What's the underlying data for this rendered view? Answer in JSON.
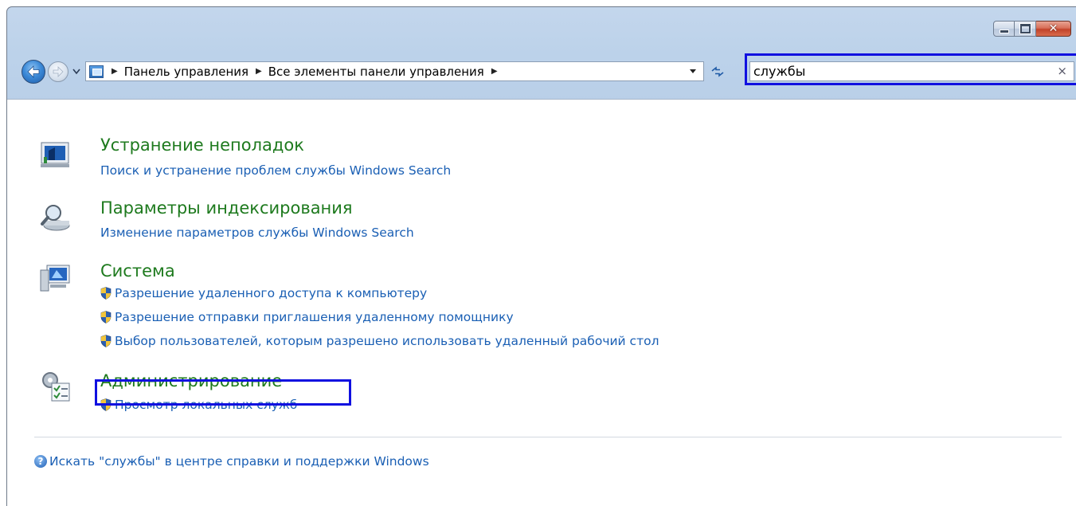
{
  "window": {
    "caption_buttons": {
      "minimize_icon": "minimize-icon",
      "maximize_icon": "maximize-icon",
      "close_glyph": "✕"
    }
  },
  "nav": {
    "breadcrumbs": [
      "Панель управления",
      "Все элементы панели управления"
    ],
    "search": {
      "value": "службы",
      "clear_glyph": "×"
    }
  },
  "groups": [
    {
      "title": "Устранение неполадок",
      "icon": "troubleshooting-icon",
      "tasks": [
        {
          "label": "Поиск и устранение проблем службы Windows Search",
          "shield": false
        }
      ]
    },
    {
      "title": "Параметры индексирования",
      "icon": "indexing-options-icon",
      "tasks": [
        {
          "label": "Изменение параметров службы Windows Search",
          "shield": false
        }
      ]
    },
    {
      "title": "Система",
      "icon": "system-icon",
      "tasks": [
        {
          "label": "Разрешение удаленного доступа к компьютеру",
          "shield": true
        },
        {
          "label": "Разрешение отправки приглашения удаленному помощнику",
          "shield": true
        },
        {
          "label": "Выбор пользователей, которым разрешено использовать удаленный рабочий стол",
          "shield": true
        }
      ]
    },
    {
      "title": "Администрирование",
      "icon": "administrative-tools-icon",
      "tasks": [
        {
          "label": "Просмотр локальных служб",
          "shield": true
        }
      ]
    }
  ],
  "help": {
    "label": "Искать \"службы\" в центре справки и поддержки Windows",
    "icon_glyph": "?"
  },
  "colors": {
    "group_title": "#1e7a1e",
    "link": "#1a5fb4",
    "highlight": "#1010e0"
  }
}
